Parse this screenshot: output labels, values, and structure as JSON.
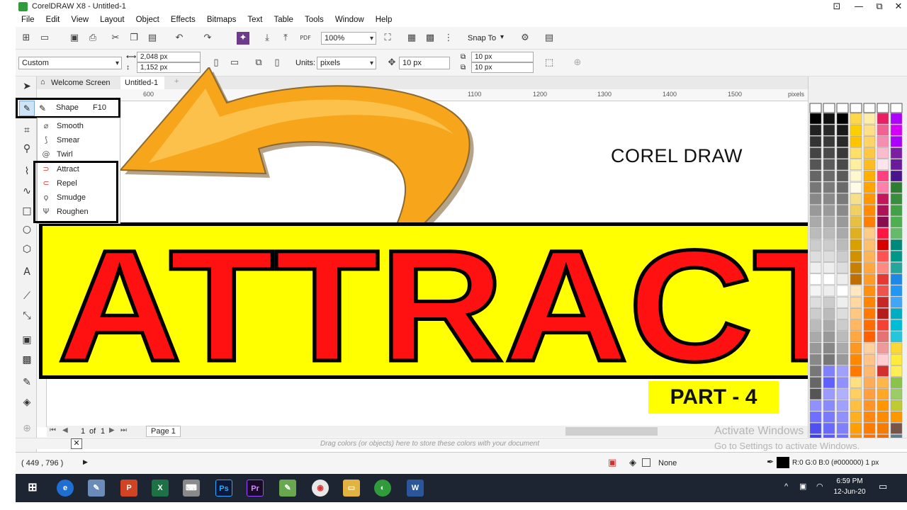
{
  "window": {
    "title": "CorelDRAW X8 - Untitled-1",
    "buttons": [
      "⊡",
      "—",
      "⧉",
      "✕"
    ]
  },
  "menu": [
    "File",
    "Edit",
    "View",
    "Layout",
    "Object",
    "Effects",
    "Bitmaps",
    "Text",
    "Table",
    "Tools",
    "Window",
    "Help"
  ],
  "standard_toolbar": {
    "zoom": "100%",
    "snap_to": "Snap To"
  },
  "property_bar": {
    "page_preset": "Custom",
    "width": "2,048 px",
    "height": "1,152 px",
    "units_label": "Units:",
    "units": "pixels",
    "nudge": "10 px",
    "dup_x": "10 px",
    "dup_y": "10 px"
  },
  "doc_tabs": {
    "welcome": "Welcome Screen",
    "doc": "Untitled-1"
  },
  "ruler": {
    "ticks": [
      "600",
      "1100",
      "1200",
      "1300",
      "1400",
      "1500",
      "pixels"
    ]
  },
  "flyout": {
    "shape_label": "Shape",
    "shape_key": "F10",
    "items": [
      "Smooth",
      "Smear",
      "Twirl",
      "Attract",
      "Repel",
      "Smudge",
      "Roughen"
    ]
  },
  "canvas": {
    "corel_text": "COREL DRAW",
    "banner_text": "ATTRACT",
    "part_text": "PART - 4",
    "colors": {
      "banner_bg": "#ffff00",
      "banner_text": "#ff1111",
      "arrow": "#f7a51a"
    }
  },
  "page_nav": {
    "current": "1",
    "of": "of",
    "total": "1",
    "page_tab": "Page 1"
  },
  "color_dock": {
    "hint": "Drag colors (or objects) here to store these colors with your document"
  },
  "watermark": {
    "line1": "Activate Windows",
    "line2": "Go to Settings to activate Windows."
  },
  "status": {
    "coords": "( 449 , 796  )",
    "fill": "None",
    "outline": "R:0 G:0 B:0 (#000000)  1 px"
  },
  "taskbar": {
    "time": "6:59 PM",
    "date": "12-Jun-20"
  }
}
